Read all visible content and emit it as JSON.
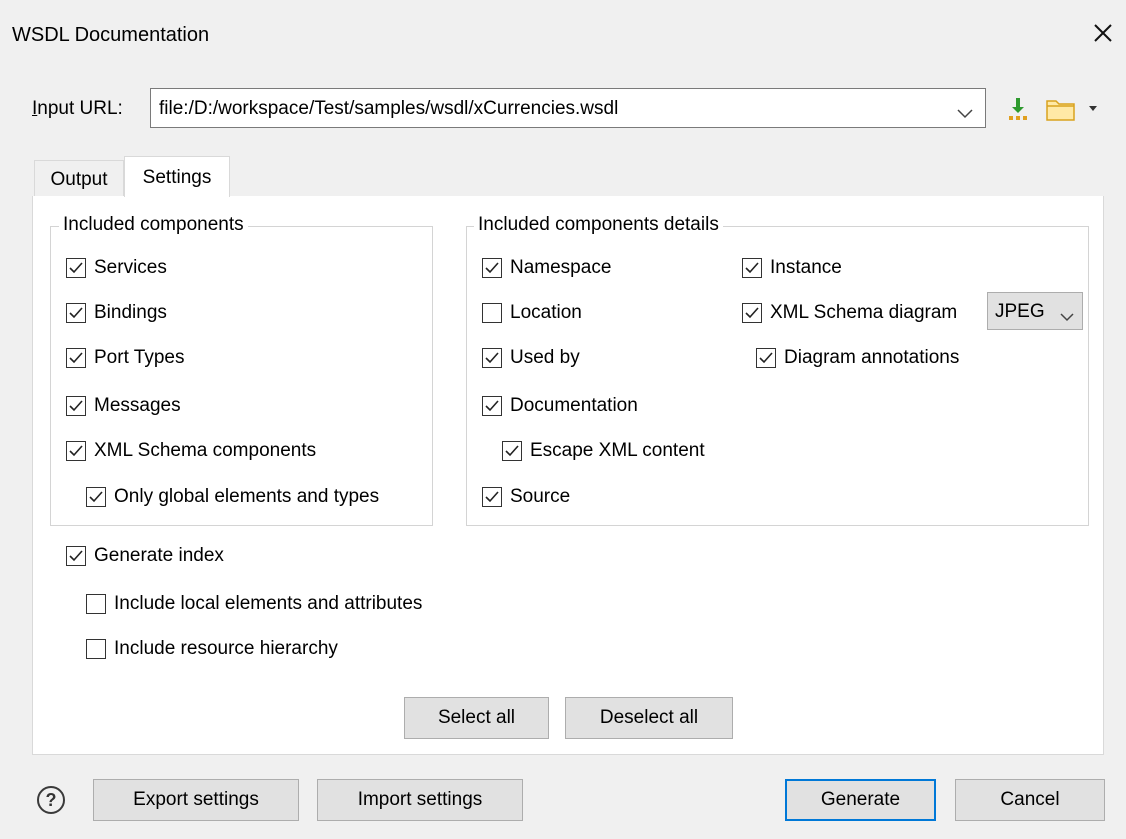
{
  "window": {
    "title": "WSDL Documentation"
  },
  "input": {
    "label": "Input URL:",
    "value": "file:/D:/workspace/Test/samples/wsdl/xCurrencies.wsdl"
  },
  "tabs": [
    {
      "label": "Output",
      "active": false
    },
    {
      "label": "Settings",
      "active": true
    }
  ],
  "included_components": {
    "legend": "Included components",
    "items": [
      {
        "label": "Services",
        "checked": true
      },
      {
        "label": "Bindings",
        "checked": true
      },
      {
        "label": "Port Types",
        "checked": true
      },
      {
        "label": "Messages",
        "checked": true
      },
      {
        "label": "XML Schema components",
        "checked": true
      },
      {
        "label": "Only global elements and types",
        "checked": true
      }
    ]
  },
  "included_details": {
    "legend": "Included components details",
    "col1": [
      {
        "label": "Namespace",
        "checked": true
      },
      {
        "label": "Location",
        "checked": false
      },
      {
        "label": "Used by",
        "checked": true
      },
      {
        "label": "Documentation",
        "checked": true
      },
      {
        "label": "Escape XML content",
        "checked": true
      },
      {
        "label": "Source",
        "checked": true
      }
    ],
    "col2": [
      {
        "label": "Instance",
        "checked": true
      },
      {
        "label": "XML Schema diagram",
        "checked": true
      },
      {
        "label": "Diagram annotations",
        "checked": true
      }
    ],
    "diagram_format": "JPEG"
  },
  "index": {
    "generate": {
      "label": "Generate index",
      "checked": true
    },
    "local": {
      "label": "Include local elements and attributes",
      "checked": false
    },
    "hierarchy": {
      "label": "Include resource hierarchy",
      "checked": false
    }
  },
  "buttons": {
    "select_all": "Select all",
    "deselect_all": "Deselect all",
    "export": "Export settings",
    "import": "Import settings",
    "generate": "Generate",
    "cancel": "Cancel",
    "help": "?"
  }
}
